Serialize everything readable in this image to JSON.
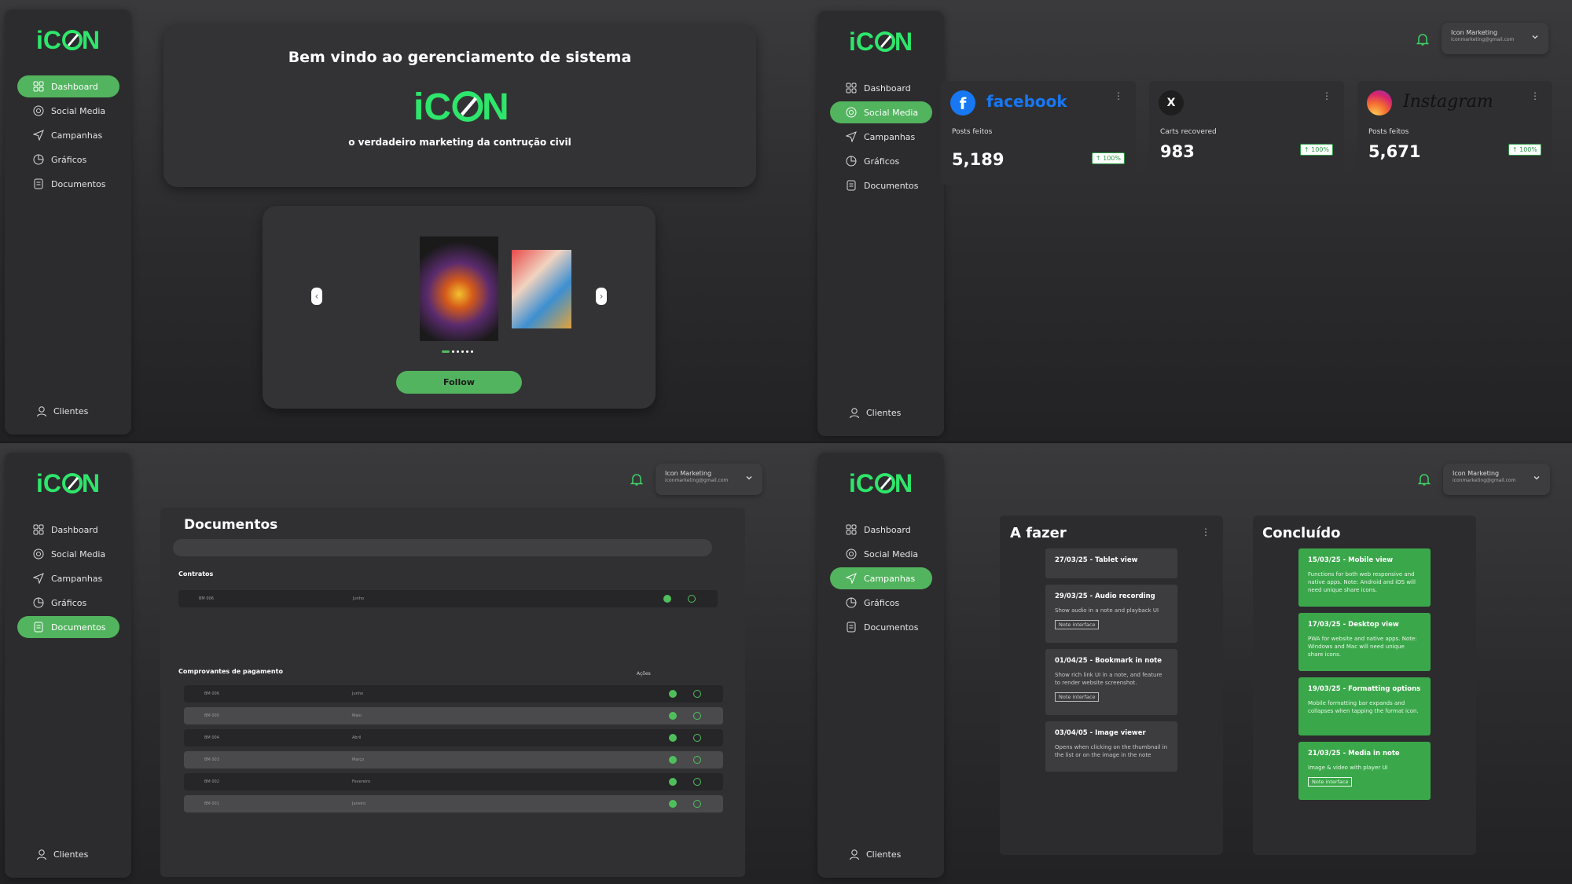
{
  "brand": {
    "logo_text": "iCON",
    "accent": "#52b45e",
    "bg": "#2c2c2e"
  },
  "nav": {
    "dashboard": "Dashboard",
    "social": "Social Media",
    "campanhas": "Campanhas",
    "graficos": "Gráficos",
    "documentos": "Documentos",
    "clientes": "Clientes"
  },
  "user": {
    "name": "Icon Marketing",
    "email": "iconmarketing@gmail.com"
  },
  "welcome": {
    "title": "Bem vindo ao gerenciamento de sistema",
    "tagline": "o verdadeiro marketing da contrução civil",
    "follow_label": "Follow"
  },
  "social": {
    "cards": [
      {
        "brand": "facebook",
        "label": "Posts feitos",
        "value": "5,189",
        "badge": "↑ 100%"
      },
      {
        "brand": "x",
        "label": "Carts recovered",
        "value": "983",
        "badge": "↑ 100%"
      },
      {
        "brand": "Instagram",
        "label": "Posts feitos",
        "value": "5,671",
        "badge": "↑ 100%"
      }
    ]
  },
  "docs": {
    "title": "Documentos",
    "contratos_label": "Contratos",
    "contrato_row": {
      "code": "BM 006",
      "month": "Junho"
    },
    "comprovantes_label": "Comprovantes de pagamento",
    "acoes_label": "Ações",
    "rows": [
      {
        "code": "BM 006",
        "month": "Junho"
      },
      {
        "code": "BM 005",
        "month": "Maio"
      },
      {
        "code": "BM 004",
        "month": "Abril"
      },
      {
        "code": "BM 003",
        "month": "Março"
      },
      {
        "code": "BM 002",
        "month": "Fevereiro"
      },
      {
        "code": "BM 001",
        "month": "Janeiro"
      }
    ]
  },
  "kanban": {
    "todo_title": "A fazer",
    "done_title": "Concluído",
    "todo": [
      {
        "title": "27/03/25 - Tablet view",
        "desc": "",
        "tag": ""
      },
      {
        "title": "29/03/25 - Audio recording",
        "desc": "Show audio in a note and playback UI",
        "tag": "Note interface"
      },
      {
        "title": "01/04/25 - Bookmark in note",
        "desc": "Show rich link UI in a note, and feature to render website screenshot.",
        "tag": "Note interface"
      },
      {
        "title": "03/04/05 - Image viewer",
        "desc": "Opens when clicking on the thumbnail in the list or on the image in the note",
        "tag": ""
      }
    ],
    "done": [
      {
        "title": "15/03/25 - Mobile view",
        "desc": "Functions for both web responsive and native apps. Note: Android and iOS will need unique share icons.",
        "tag": ""
      },
      {
        "title": "17/03/25 - Desktop view",
        "desc": "PWA for website and native apps. Note: Windows and Mac will need unique share icons.",
        "tag": ""
      },
      {
        "title": "19/03/25 - Formatting options",
        "desc": "Mobile formatting bar expands and collapses when tapping the format icon.",
        "tag": ""
      },
      {
        "title": "21/03/25 - Media in note",
        "desc": "Image & video with player UI",
        "tag": "Note interface"
      }
    ]
  }
}
